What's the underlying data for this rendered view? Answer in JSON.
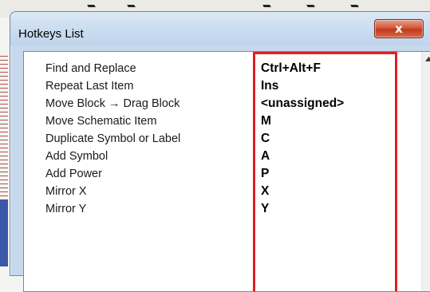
{
  "dialog": {
    "title": "Hotkeys List",
    "close_glyph": "x"
  },
  "hotkeys": [
    {
      "command": "Find and Replace",
      "key": "Ctrl+Alt+F"
    },
    {
      "command": "Repeat Last Item",
      "key": "Ins"
    },
    {
      "command": "Move Block → Drag Block",
      "key": "<unassigned>"
    },
    {
      "command": "Move Schematic Item",
      "key": "M"
    },
    {
      "command": "Duplicate Symbol or Label",
      "key": "C"
    },
    {
      "command": "Add Symbol",
      "key": "A"
    },
    {
      "command": "Add Power",
      "key": "P"
    },
    {
      "command": "Mirror X",
      "key": "X"
    },
    {
      "command": "Mirror Y",
      "key": "Y"
    }
  ],
  "scrollbar": {
    "up_arrow_icon": "triangle-up"
  },
  "colors": {
    "highlight": "#e01f26",
    "close": "#c2391c"
  }
}
